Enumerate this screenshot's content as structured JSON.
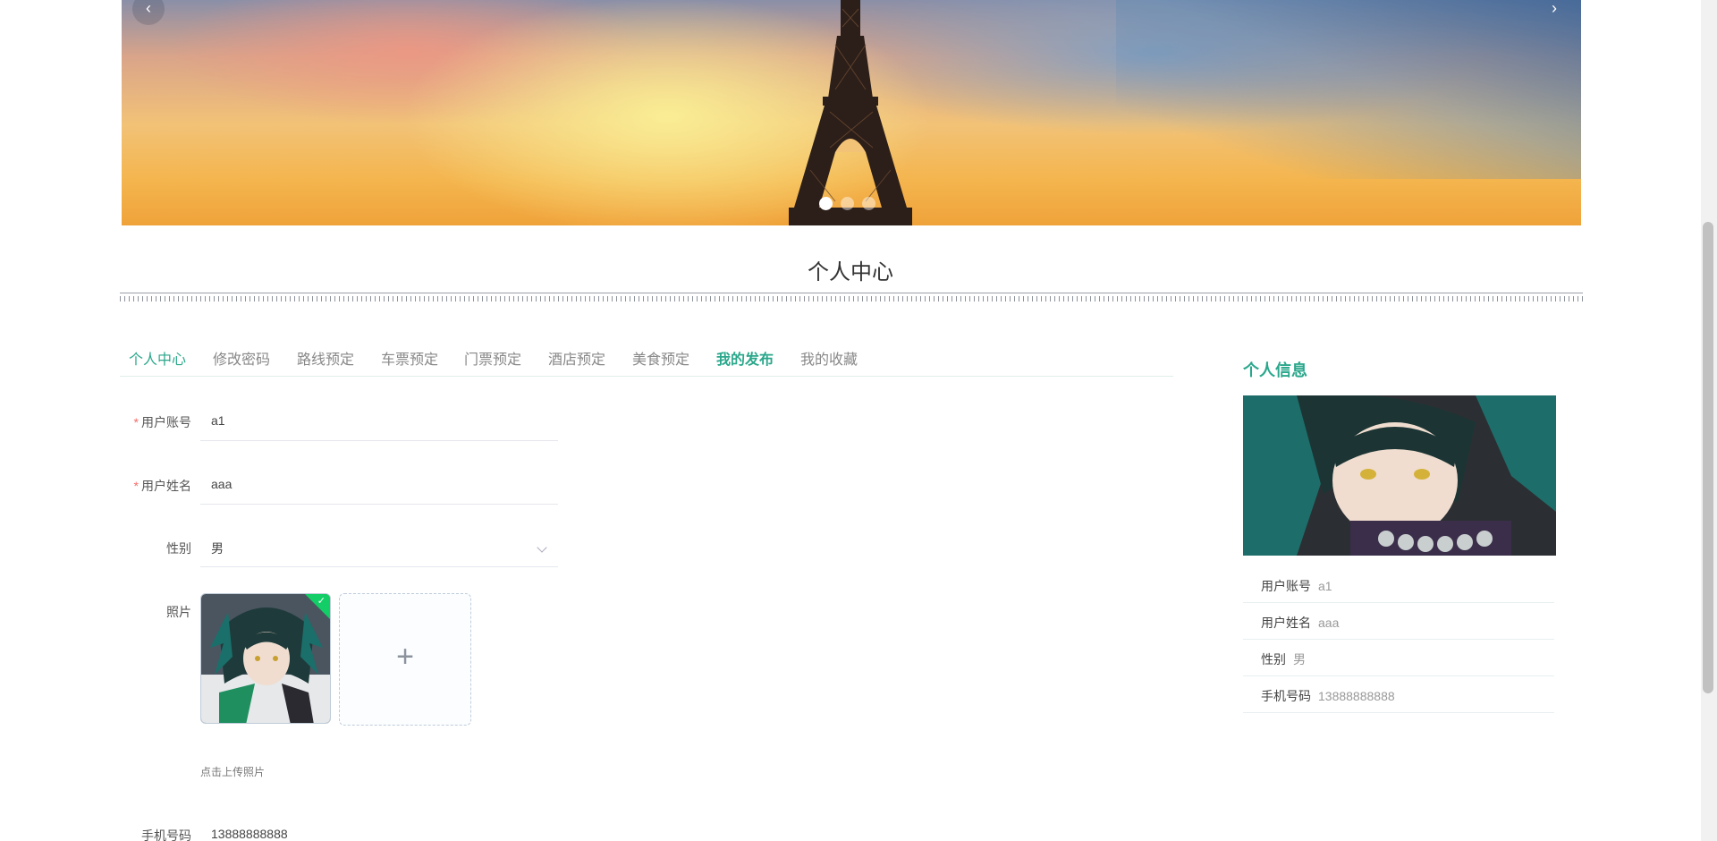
{
  "banner": {
    "prev_arrow": "‹",
    "next_arrow": "›",
    "slide_count": 3,
    "active_slide": 1
  },
  "page_title": "个人中心",
  "tabs": [
    {
      "label": "个人中心",
      "state": "active"
    },
    {
      "label": "修改密码",
      "state": "normal"
    },
    {
      "label": "路线预定",
      "state": "normal"
    },
    {
      "label": "车票预定",
      "state": "normal"
    },
    {
      "label": "门票预定",
      "state": "normal"
    },
    {
      "label": "酒店预定",
      "state": "normal"
    },
    {
      "label": "美食预定",
      "state": "normal"
    },
    {
      "label": "我的发布",
      "state": "bold"
    },
    {
      "label": "我的收藏",
      "state": "normal"
    }
  ],
  "form": {
    "account": {
      "label": "用户账号",
      "value": "a1",
      "required": "*"
    },
    "name": {
      "label": "用户姓名",
      "value": "aaa",
      "required": "*"
    },
    "gender": {
      "label": "性别",
      "value": "男"
    },
    "photo": {
      "label": "照片",
      "plus": "+",
      "tip": "点击上传照片",
      "check": "✓"
    },
    "phone": {
      "label": "手机号码",
      "value": "13888888888"
    }
  },
  "side": {
    "title": "个人信息",
    "rows": [
      {
        "key": "用户账号",
        "value": "a1"
      },
      {
        "key": "用户姓名",
        "value": "aaa"
      },
      {
        "key": "性别",
        "value": "男"
      },
      {
        "key": "手机号码",
        "value": "13888888888"
      }
    ]
  },
  "colors": {
    "accent": "#2aa78b",
    "required": "#f56c6c",
    "success": "#13ce66"
  }
}
